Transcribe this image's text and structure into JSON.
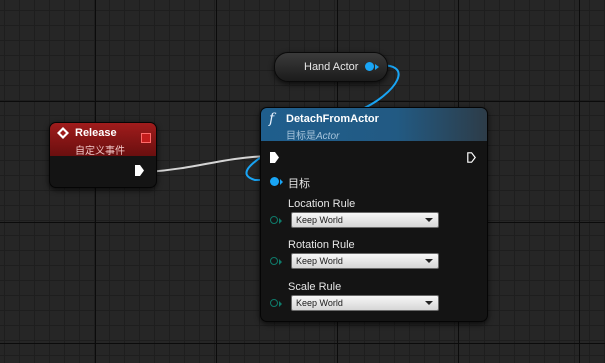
{
  "hand_actor_node": {
    "label": "Hand Actor"
  },
  "release_node": {
    "title": "Release",
    "subtitle": "自定义事件"
  },
  "detach_node": {
    "function_icon": "f",
    "title": "DetachFromActor",
    "subtitle_prefix": "目标是",
    "subtitle_class": "Actor",
    "target_label": "目标",
    "rules": [
      {
        "label": "Location Rule",
        "value": "Keep World"
      },
      {
        "label": "Rotation Rule",
        "value": "Keep World"
      },
      {
        "label": "Scale Rule",
        "value": "Keep World"
      }
    ]
  },
  "colors": {
    "object_pin": "#19a5f5",
    "enum_pin": "#0f7a6a",
    "event_header": "#a01c1c",
    "function_header": "#1f5e8d",
    "exec_wire": "#d9d9d9"
  },
  "icons": [
    "event-diamond-icon",
    "delegate-square-icon",
    "function-f-icon",
    "exec-arrow-icon",
    "dropdown-caret-icon"
  ]
}
